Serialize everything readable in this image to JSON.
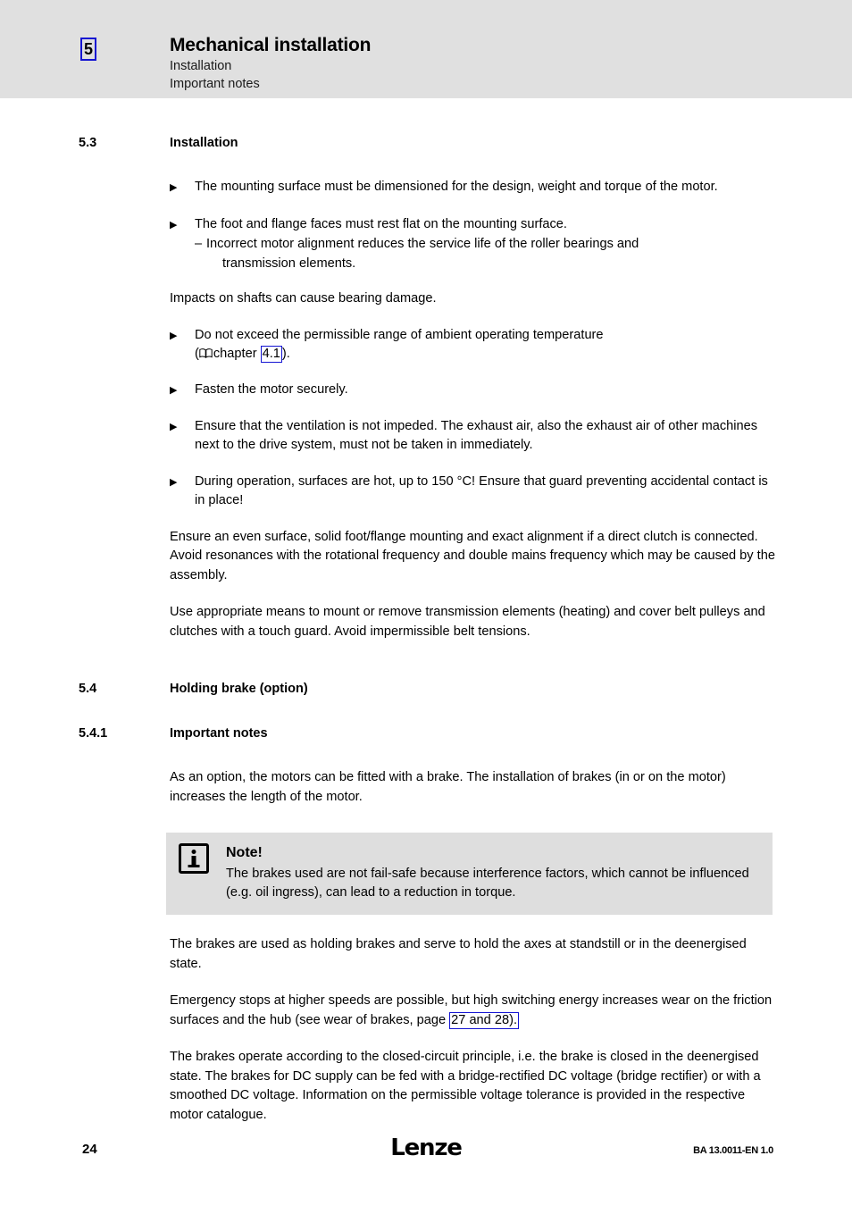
{
  "header": {
    "chapter_number": "5",
    "title": "Mechanical installation",
    "subtitle_1": "Installation",
    "subtitle_2": "Important notes"
  },
  "sections": {
    "s53": {
      "number": "5.3",
      "title": "Installation"
    },
    "s54": {
      "number": "5.4",
      "title": "Holding brake (option)"
    },
    "s541": {
      "number": "5.4.1",
      "title": "Important notes"
    }
  },
  "content": {
    "bullet_1": "The mounting surface must be dimensioned for the design, weight and torque of the motor.",
    "bullet_2": "The foot and flange faces must rest flat on the mounting surface.",
    "sub_bullet_2a_line1": "Incorrect motor alignment reduces the service life of the roller bearings and",
    "sub_bullet_2a_line2": "transmission elements.",
    "para_impacts": "Impacts on shafts can cause bearing damage.",
    "bullet_3_part1": "Do not exceed the permissible range of ambient operating temperature",
    "bullet_3_open": "(",
    "bullet_3_chapter_word": "chapter",
    "bullet_3_link": "4.1",
    "bullet_3_close": ").",
    "bullet_4": "Fasten the motor securely.",
    "bullet_5": "Ensure that the ventilation is not impeded. The exhaust air, also the exhaust air of other machines next to the drive system, must not be taken in immediately.",
    "bullet_6": "During operation, surfaces are hot, up to 150 °C! Ensure that guard preventing accidental contact is in place!",
    "para_even_surface": "Ensure an even surface, solid foot/flange mounting and exact alignment if a direct clutch is connected. Avoid resonances with the rotational frequency and double mains frequency which may be caused by the assembly.",
    "para_transmission": "Use appropriate means to mount or remove transmission elements (heating) and cover belt pulleys and clutches with a touch guard. Avoid impermissible belt tensions.",
    "para_brake_option": "As an option, the motors can be fitted with a brake. The installation of brakes (in or on the motor) increases the length of the motor.",
    "para_holding_brakes": "The brakes are used as holding brakes and serve to hold the axes at standstill or in the deenergised state.",
    "para_emergency_part1": "Emergency stops at higher speeds are possible, but high switching energy increases wear on the friction surfaces and the hub (see wear of brakes, page",
    "para_emergency_link": "27 and  28).",
    "para_closed_circuit": "The brakes operate according to the closed-circuit principle, i.e. the brake is closed in the deenergised state. The brakes for DC supply can be fed with a bridge-rectified DC voltage (bridge rectifier) or with a smoothed DC voltage. Information on the permissible voltage tolerance is provided in the respective motor catalogue."
  },
  "note": {
    "title": "Note!",
    "text": "The brakes used are not fail-safe because interference factors, which cannot be influenced (e.g. oil ingress), can lead to a reduction in torque."
  },
  "footer": {
    "page_number": "24",
    "logo": "Lenze",
    "document_id": "BA 13.0011-EN   1.0"
  },
  "markers": {
    "bullet": "▶",
    "sub_bullet": "–"
  },
  "colors": {
    "header_band": "#e0e0e0",
    "link_border": "#1414d2",
    "note_background": "#dedede"
  }
}
